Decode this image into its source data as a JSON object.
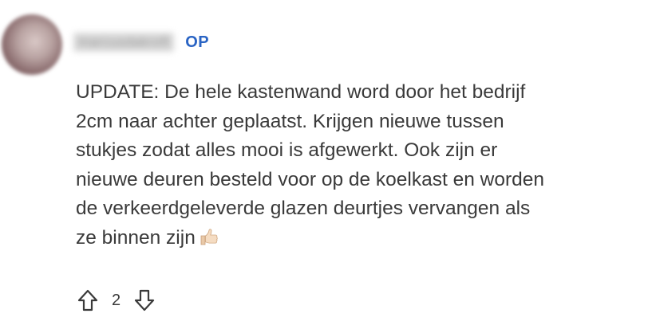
{
  "comment": {
    "username": "marcusdakroft",
    "op_label": "OP",
    "body": "UPDATE: De hele kastenwand word door het bedrijf\n2cm naar achter geplaatst. Krijgen nieuwe tussen\nstukjes zodat alles mooi is afgewerkt. Ook zijn er\nnieuwe deuren besteld voor op de koelkast en worden\nde verkeerdgeleverde glazen deurtjes vervangen als\nze binnen zijn",
    "emoji": "thumbs-up-light-skin-tone",
    "vote_count": "2"
  },
  "icons": {
    "upvote": "upvote-arrow-icon",
    "downvote": "downvote-arrow-icon"
  },
  "colors": {
    "op_badge": "#2a64c4",
    "text": "#3a3a3a"
  }
}
